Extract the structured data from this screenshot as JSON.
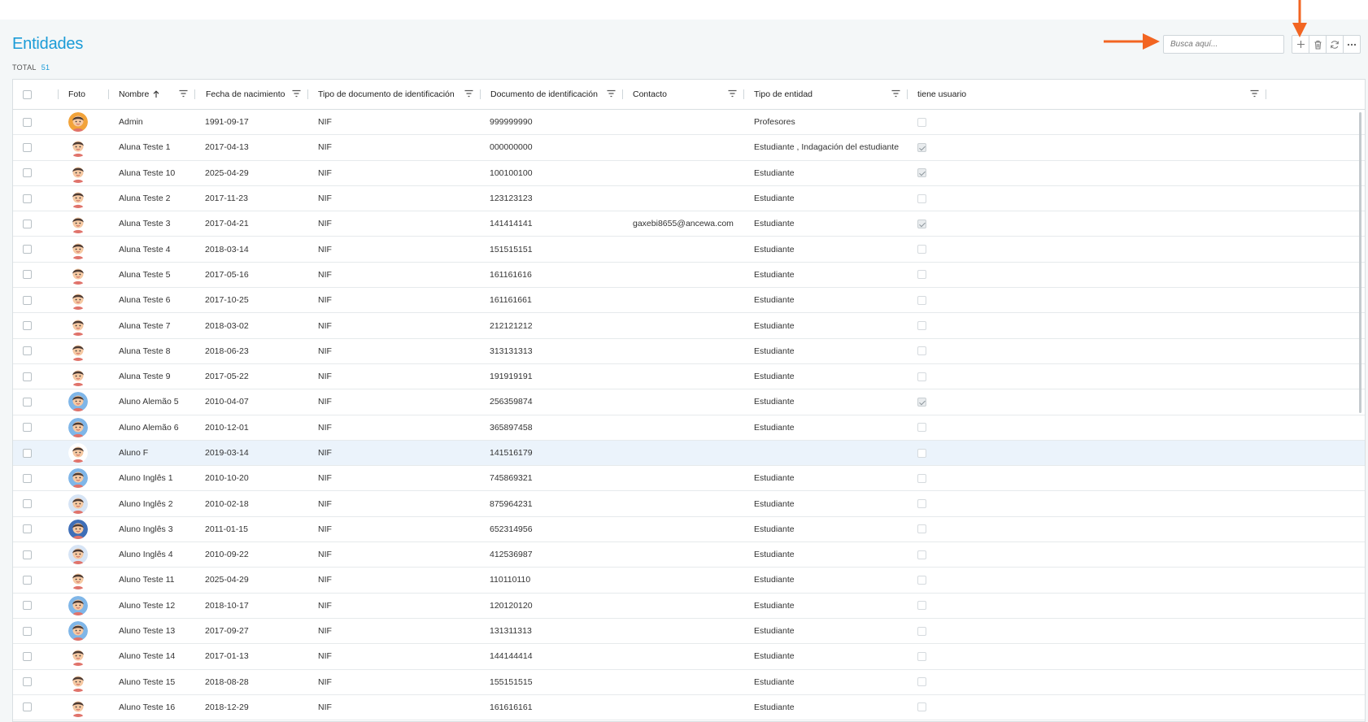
{
  "header": {
    "title": "Entidades",
    "total_label": "TOTAL",
    "total_count": "51"
  },
  "search": {
    "placeholder": "Busca aquí..."
  },
  "toolbar": {
    "add_icon": "plus-icon",
    "delete_icon": "trash-icon",
    "refresh_icon": "refresh-icon",
    "more_icon": "ellipsis-icon"
  },
  "columns": [
    {
      "label": "Foto"
    },
    {
      "label": "Nombre"
    },
    {
      "label": "Fecha de nacimiento"
    },
    {
      "label": "Tipo de documento de identificación"
    },
    {
      "label": "Documento de identificación"
    },
    {
      "label": "Contacto"
    },
    {
      "label": "Tipo de entidad"
    },
    {
      "label": "tiene usuario"
    }
  ],
  "colors": {
    "accent": "#1a9bd7",
    "annotation_arrow": "#f26522",
    "selected_row": "#ebf3fb"
  },
  "rows": [
    {
      "name": "Admin",
      "birth": "1991-09-17",
      "doc_type": "NIF",
      "doc": "999999990",
      "contact": "",
      "entity_type": "Profesores",
      "has_user": false,
      "avatar": "#f2a33a"
    },
    {
      "name": "Aluna Teste 1",
      "birth": "2017-04-13",
      "doc_type": "NIF",
      "doc": "000000000",
      "contact": "",
      "entity_type": "Estudiante , Indagación del estudiante",
      "has_user": true,
      "avatar": "#ffffff"
    },
    {
      "name": "Aluna Teste 10",
      "birth": "2025-04-29",
      "doc_type": "NIF",
      "doc": "100100100",
      "contact": "",
      "entity_type": "Estudiante",
      "has_user": true,
      "avatar": "#ffffff"
    },
    {
      "name": "Aluna Teste 2",
      "birth": "2017-11-23",
      "doc_type": "NIF",
      "doc": "123123123",
      "contact": "",
      "entity_type": "Estudiante",
      "has_user": false,
      "avatar": "#ffffff"
    },
    {
      "name": "Aluna Teste 3",
      "birth": "2017-04-21",
      "doc_type": "NIF",
      "doc": "141414141",
      "contact": "gaxebi8655@ancewa.com",
      "entity_type": "Estudiante",
      "has_user": true,
      "avatar": "#ffffff"
    },
    {
      "name": "Aluna Teste 4",
      "birth": "2018-03-14",
      "doc_type": "NIF",
      "doc": "151515151",
      "contact": "",
      "entity_type": "Estudiante",
      "has_user": false,
      "avatar": "#ffffff"
    },
    {
      "name": "Aluna Teste 5",
      "birth": "2017-05-16",
      "doc_type": "NIF",
      "doc": "161161616",
      "contact": "",
      "entity_type": "Estudiante",
      "has_user": false,
      "avatar": "#ffffff"
    },
    {
      "name": "Aluna Teste 6",
      "birth": "2017-10-25",
      "doc_type": "NIF",
      "doc": "161161661",
      "contact": "",
      "entity_type": "Estudiante",
      "has_user": false,
      "avatar": "#ffffff"
    },
    {
      "name": "Aluna Teste 7",
      "birth": "2018-03-02",
      "doc_type": "NIF",
      "doc": "212121212",
      "contact": "",
      "entity_type": "Estudiante",
      "has_user": false,
      "avatar": "#ffffff"
    },
    {
      "name": "Aluna Teste 8",
      "birth": "2018-06-23",
      "doc_type": "NIF",
      "doc": "313131313",
      "contact": "",
      "entity_type": "Estudiante",
      "has_user": false,
      "avatar": "#ffffff"
    },
    {
      "name": "Aluna Teste 9",
      "birth": "2017-05-22",
      "doc_type": "NIF",
      "doc": "191919191",
      "contact": "",
      "entity_type": "Estudiante",
      "has_user": false,
      "avatar": "#ffffff"
    },
    {
      "name": "Aluno Alemão 5",
      "birth": "2010-04-07",
      "doc_type": "NIF",
      "doc": "256359874",
      "contact": "",
      "entity_type": "Estudiante",
      "has_user": true,
      "avatar": "#7fb6e8"
    },
    {
      "name": "Aluno Alemão 6",
      "birth": "2010-12-01",
      "doc_type": "NIF",
      "doc": "365897458",
      "contact": "",
      "entity_type": "Estudiante",
      "has_user": false,
      "avatar": "#7fb6e8"
    },
    {
      "name": "Aluno F",
      "birth": "2019-03-14",
      "doc_type": "NIF",
      "doc": "141516179",
      "contact": "",
      "entity_type": "",
      "has_user": false,
      "avatar": "#ffffff",
      "selected": true
    },
    {
      "name": "Aluno Inglês 1",
      "birth": "2010-10-20",
      "doc_type": "NIF",
      "doc": "745869321",
      "contact": "",
      "entity_type": "Estudiante",
      "has_user": false,
      "avatar": "#7fb6e8"
    },
    {
      "name": "Aluno Inglês 2",
      "birth": "2010-02-18",
      "doc_type": "NIF",
      "doc": "875964231",
      "contact": "",
      "entity_type": "Estudiante",
      "has_user": false,
      "avatar": "#d6e4f5"
    },
    {
      "name": "Aluno Inglês 3",
      "birth": "2011-01-15",
      "doc_type": "NIF",
      "doc": "652314956",
      "contact": "",
      "entity_type": "Estudiante",
      "has_user": false,
      "avatar": "#3f6fb8"
    },
    {
      "name": "Aluno Inglês 4",
      "birth": "2010-09-22",
      "doc_type": "NIF",
      "doc": "412536987",
      "contact": "",
      "entity_type": "Estudiante",
      "has_user": false,
      "avatar": "#d6e4f5"
    },
    {
      "name": "Aluno Teste 11",
      "birth": "2025-04-29",
      "doc_type": "NIF",
      "doc": "110110110",
      "contact": "",
      "entity_type": "Estudiante",
      "has_user": false,
      "avatar": "#ffffff"
    },
    {
      "name": "Aluno Teste 12",
      "birth": "2018-10-17",
      "doc_type": "NIF",
      "doc": "120120120",
      "contact": "",
      "entity_type": "Estudiante",
      "has_user": false,
      "avatar": "#7fb6e8"
    },
    {
      "name": "Aluno Teste 13",
      "birth": "2017-09-27",
      "doc_type": "NIF",
      "doc": "131311313",
      "contact": "",
      "entity_type": "Estudiante",
      "has_user": false,
      "avatar": "#7fb6e8"
    },
    {
      "name": "Aluno Teste 14",
      "birth": "2017-01-13",
      "doc_type": "NIF",
      "doc": "144144414",
      "contact": "",
      "entity_type": "Estudiante",
      "has_user": false,
      "avatar": "#ffffff"
    },
    {
      "name": "Aluno Teste 15",
      "birth": "2018-08-28",
      "doc_type": "NIF",
      "doc": "155151515",
      "contact": "",
      "entity_type": "Estudiante",
      "has_user": false,
      "avatar": "#ffffff"
    },
    {
      "name": "Aluno Teste 16",
      "birth": "2018-12-29",
      "doc_type": "NIF",
      "doc": "161616161",
      "contact": "",
      "entity_type": "Estudiante",
      "has_user": false,
      "avatar": "#ffffff"
    }
  ]
}
